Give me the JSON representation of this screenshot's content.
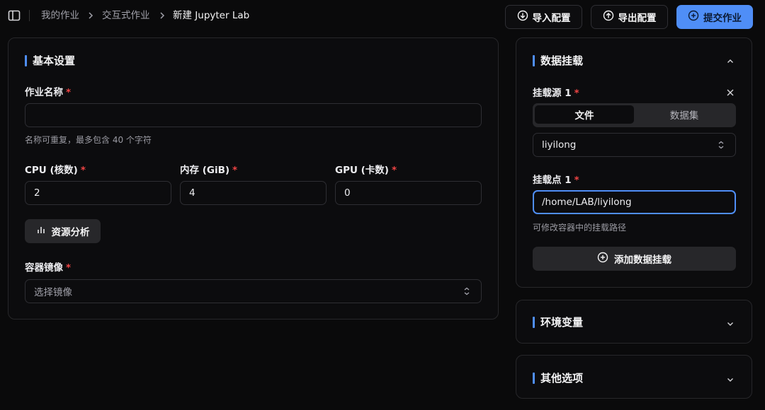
{
  "header": {
    "breadcrumb": [
      "我的作业",
      "交互式作业",
      "新建 Jupyter Lab"
    ],
    "buttons": {
      "import_label": "导入配置",
      "export_label": "导出配置",
      "submit_label": "提交作业"
    }
  },
  "basic": {
    "title": "基本设置",
    "job_name": {
      "label": "作业名称",
      "value": "",
      "hint": "名称可重复，最多包含 40 个字符"
    },
    "cpu": {
      "label": "CPU (核数)",
      "value": "2"
    },
    "memory": {
      "label": "内存 (GiB)",
      "value": "4"
    },
    "gpu": {
      "label": "GPU (卡数)",
      "value": "0"
    },
    "analyze_label": "资源分析",
    "image": {
      "label": "容器镜像",
      "placeholder": "选择镜像"
    },
    "required_mark": "*"
  },
  "mount": {
    "title": "数据挂载",
    "source_label": "挂载源 1",
    "tabs": [
      "文件",
      "数据集"
    ],
    "active_tab": "文件",
    "source_value": "liyilong",
    "point_label": "挂载点 1",
    "point_value": "/home/LAB/liyilong",
    "point_hint": "可修改容器中的挂载路径",
    "add_label": "添加数据挂载"
  },
  "env": {
    "title": "环境变量"
  },
  "other": {
    "title": "其他选项"
  },
  "colors": {
    "accent": "#4f8ef7",
    "required": "#ef4444",
    "background": "#0a0a0b"
  }
}
